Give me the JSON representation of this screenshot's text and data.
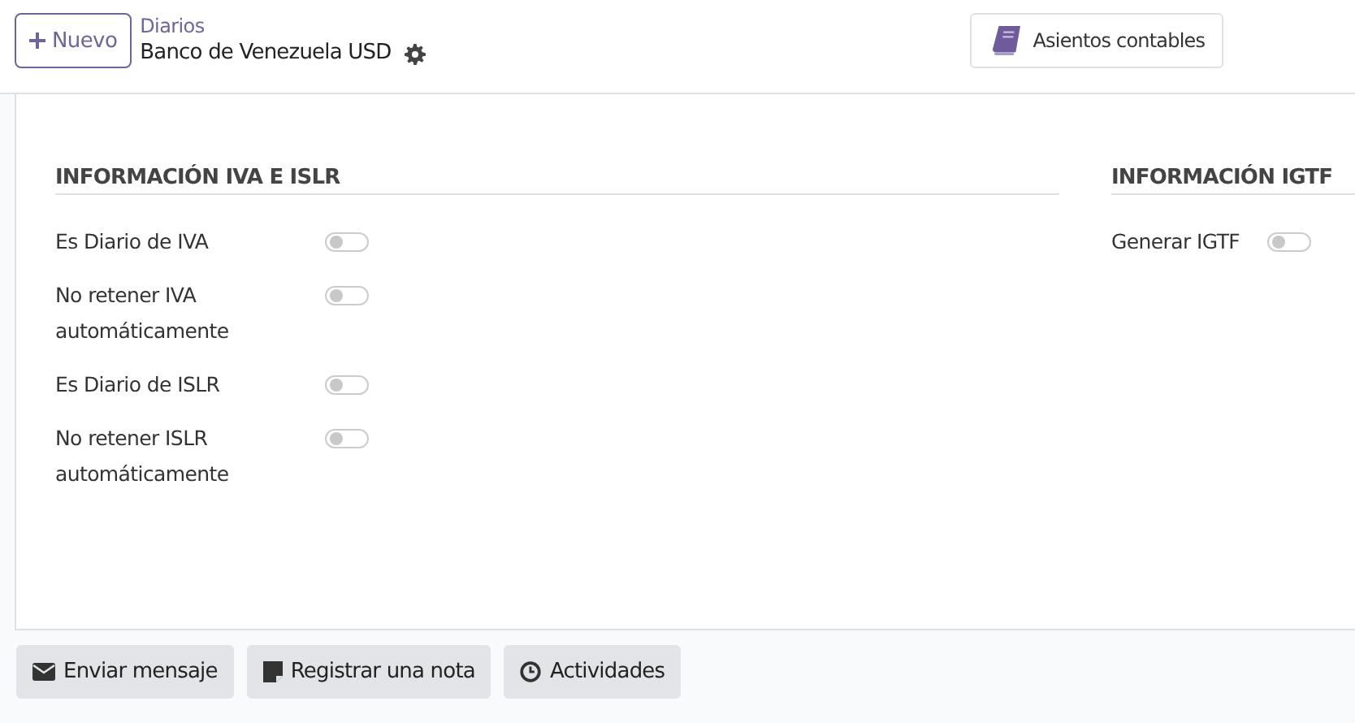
{
  "control_panel": {
    "new_button": "Nuevo",
    "breadcrumb": "Diarios",
    "record_title": "Banco de Venezuela USD",
    "smart_buttons": [
      "Asientos contables"
    ]
  },
  "groups": [
    {
      "title": "INFORMACIÓN IVA E ISLR",
      "fields": [
        {
          "label": "Es Diario de IVA",
          "checked": false
        },
        {
          "label": "No retener IVA automáticamente",
          "checked": false
        },
        {
          "label": "Es Diario de ISLR",
          "checked": false
        },
        {
          "label": "No retener ISLR automáticamente",
          "checked": false
        }
      ]
    },
    {
      "title": "INFORMACIÓN IGTF",
      "fields": [
        {
          "label": "Generar IGTF",
          "checked": false
        }
      ]
    }
  ],
  "chatter_buttons": [
    {
      "kind": "message",
      "label": "Enviar mensaje"
    },
    {
      "kind": "note",
      "label": "Registrar una nota"
    },
    {
      "kind": "activities",
      "label": "Actividades"
    }
  ]
}
